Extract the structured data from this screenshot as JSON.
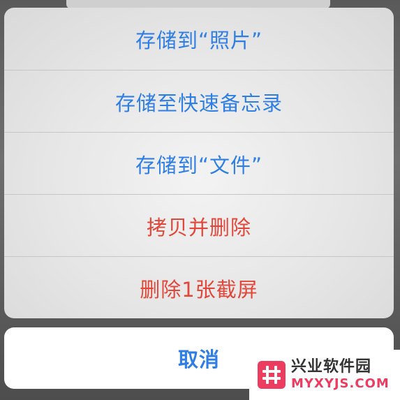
{
  "action_sheet": {
    "actions": [
      {
        "label": "存储到“照片”",
        "style": "default"
      },
      {
        "label": "存储至快速备忘录",
        "style": "default"
      },
      {
        "label": "存储到“文件”",
        "style": "default"
      },
      {
        "label": "拷贝并删除",
        "style": "destructive"
      },
      {
        "label": "删除1张截屏",
        "style": "destructive"
      }
    ],
    "cancel_label": "取消"
  },
  "watermark": {
    "title": "兴业软件园",
    "subtitle": "MYXYJS.COM"
  },
  "colors": {
    "accent": "#2f7ee6",
    "destructive": "#e2473a",
    "watermark_brand": "#ec3c5f"
  }
}
